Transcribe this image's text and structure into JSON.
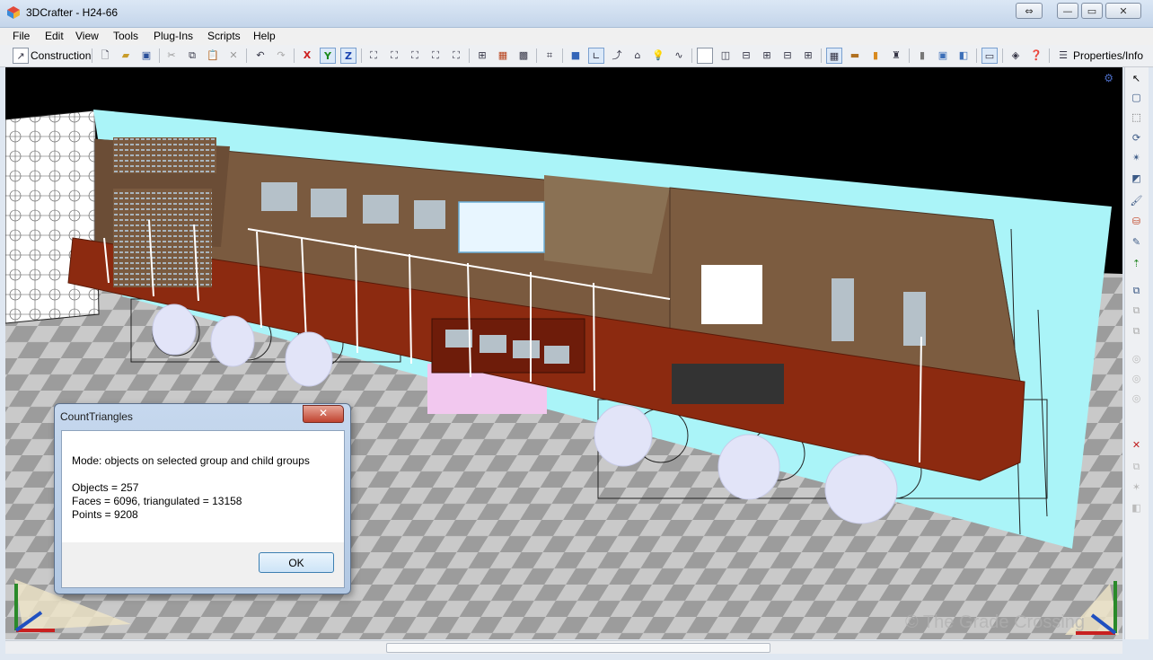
{
  "window": {
    "title": "3DCrafter - H24-66",
    "restore_symbol": "⇔",
    "minimize_symbol": "—",
    "maximize_symbol": "▭",
    "close_symbol": "✕"
  },
  "menu": {
    "items": [
      "File",
      "Edit",
      "View",
      "Tools",
      "Plug-Ins",
      "Scripts",
      "Help"
    ]
  },
  "toolbar": {
    "mode_label": "Construction",
    "axis_x": "X",
    "axis_y": "Y",
    "axis_z": "Z",
    "properties_label": "Properties/Info",
    "colors": {
      "x": "#cc2020",
      "y": "#1a8a1a",
      "z": "#1a44b0"
    }
  },
  "viewport": {
    "watermark": "© The Grade Crossing",
    "colors": {
      "background": "#000000",
      "body": "#7a5a3f",
      "frame": "#8c2a10",
      "blueprint": "#aaf4f8",
      "wheels": "#e2e4f8"
    }
  },
  "dialog": {
    "title": "CountTriangles",
    "close_symbol": "✕",
    "mode_line": "Mode: objects on selected group and child groups",
    "objects_line": "Objects = 257",
    "faces_line": "Faces = 6096, triangulated = 13158",
    "points_line": "Points = 9208",
    "ok_label": "OK"
  }
}
